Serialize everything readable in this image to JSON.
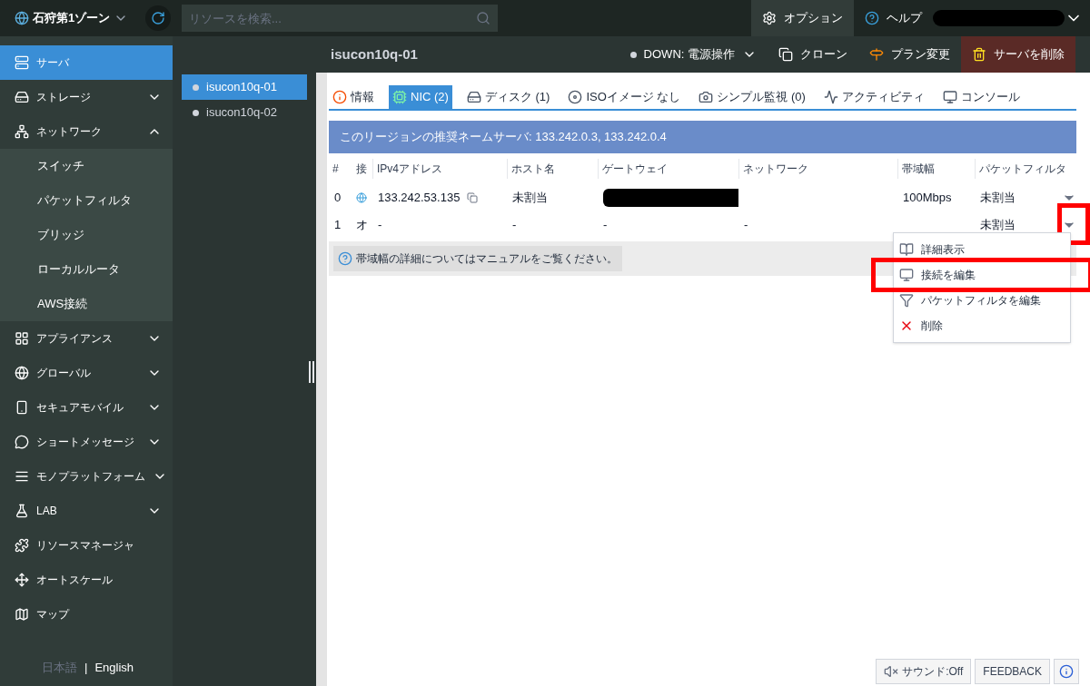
{
  "top_bar": {
    "zone": "石狩第1ゾーン",
    "search": {
      "placeholder": "リソースを検索..."
    },
    "options": "オプション",
    "help": "ヘルプ"
  },
  "sidebar": {
    "items": [
      {
        "label": "サーバ",
        "kind": "link",
        "selected": true
      },
      {
        "label": "ストレージ",
        "kind": "group",
        "selected": false,
        "expanded": false
      },
      {
        "label": "ネットワーク",
        "kind": "group",
        "selected": false,
        "expanded": true,
        "children": [
          {
            "label": "スイッチ"
          },
          {
            "label": "パケットフィルタ"
          },
          {
            "label": "ブリッジ"
          },
          {
            "label": "ローカルルータ"
          },
          {
            "label": "AWS接続"
          }
        ]
      },
      {
        "label": "アプライアンス",
        "kind": "group",
        "selected": false,
        "expanded": false
      },
      {
        "label": "グローバル",
        "kind": "group",
        "selected": false,
        "expanded": false
      },
      {
        "label": "セキュアモバイル",
        "kind": "group",
        "selected": false,
        "expanded": false
      },
      {
        "label": "ショートメッセージ",
        "kind": "group",
        "selected": false,
        "expanded": false
      },
      {
        "label": "モノプラットフォーム",
        "kind": "group",
        "selected": false,
        "expanded": false
      },
      {
        "label": "LAB",
        "kind": "group",
        "selected": false,
        "expanded": false
      },
      {
        "label": "リソースマネージャ",
        "kind": "link",
        "selected": false
      },
      {
        "label": "オートスケール",
        "kind": "link",
        "selected": false
      },
      {
        "label": "マップ",
        "kind": "link",
        "selected": false
      }
    ],
    "languages": [
      {
        "label": "日本語",
        "selected": true
      },
      {
        "label": "English",
        "selected": false
      }
    ],
    "language_separator": "|"
  },
  "servers": [
    {
      "name": "isucon10q-01",
      "selected": true
    },
    {
      "name": "isucon10q-02",
      "selected": false
    }
  ],
  "toolbar": {
    "title": "isucon10q-01",
    "power": "DOWN: 電源操作",
    "clone": "クローン",
    "plan": "プラン変更",
    "delete": "サーバを削除"
  },
  "tabs": [
    {
      "label": "情報",
      "selected": false
    },
    {
      "label": "NIC (2)",
      "selected": true
    },
    {
      "label": "ディスク (1)",
      "selected": false
    },
    {
      "label": "ISOイメージ なし",
      "selected": false
    },
    {
      "label": "シンプル監視 (0)",
      "selected": false
    },
    {
      "label": "アクティビティ",
      "selected": false
    },
    {
      "label": "コンソール",
      "selected": false
    }
  ],
  "banner": "このリージョンの推奨ネームサーバ: 133.242.0.3, 133.242.0.4",
  "table": {
    "columns": [
      "#",
      "接",
      "IPv4アドレス",
      "ホスト名",
      "ゲートウェイ",
      "ネットワーク",
      "帯域幅",
      "パケットフィルタ"
    ],
    "rows": [
      {
        "index": "0",
        "connection": "",
        "ipv4": "133.242.53.135",
        "host": "未割当",
        "gateway": "",
        "network": "",
        "bandwidth": "100Mbps",
        "packet_filter": "未割当"
      },
      {
        "index": "1",
        "connection": "オ",
        "ipv4": "-",
        "host": "-",
        "gateway": "-",
        "network": "-",
        "bandwidth": "",
        "packet_filter": "未割当"
      }
    ]
  },
  "note": "帯域幅の詳細についてはマニュアルをご覧ください。",
  "context_menu": {
    "items": [
      {
        "label": "詳細表示",
        "highlighted": false
      },
      {
        "label": "接続を編集",
        "highlighted": true
      },
      {
        "label": "パケットフィルタを編集",
        "highlighted": false
      },
      {
        "label": "削除",
        "highlighted": false
      }
    ]
  },
  "footer": {
    "sound": "サウンド:Off",
    "feedback": "FEEDBACK"
  }
}
